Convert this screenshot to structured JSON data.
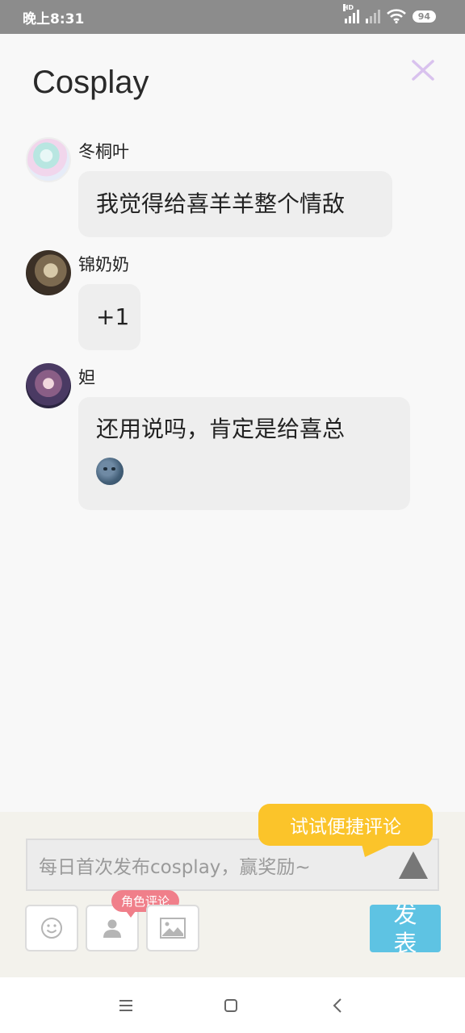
{
  "status_bar": {
    "time": "晚上8:31",
    "signal_badge": "HD",
    "battery": "94"
  },
  "header": {
    "title": "Cosplay",
    "close_icon": "close-icon",
    "close_color": "#d9c2ee"
  },
  "comments": [
    {
      "name": "冬桐叶",
      "lines": [
        "我觉得给喜羊羊整个情敌"
      ]
    },
    {
      "name": "锦奶奶",
      "lines": [
        "+1"
      ]
    },
    {
      "name": "妲",
      "lines": [
        "还用说吗，肯定是给喜总"
      ],
      "emoji": "new-moon-face"
    }
  ],
  "composer": {
    "tooltip": "试试便捷评论",
    "placeholder": "每日首次发布cosplay，赢奖励~",
    "role_tag": "角色评论",
    "send_label_1": "发",
    "send_label_2": "表",
    "colors": {
      "tooltip": "#fbc42a",
      "send": "#5ec3e3",
      "tag": "#f07f8a"
    }
  }
}
